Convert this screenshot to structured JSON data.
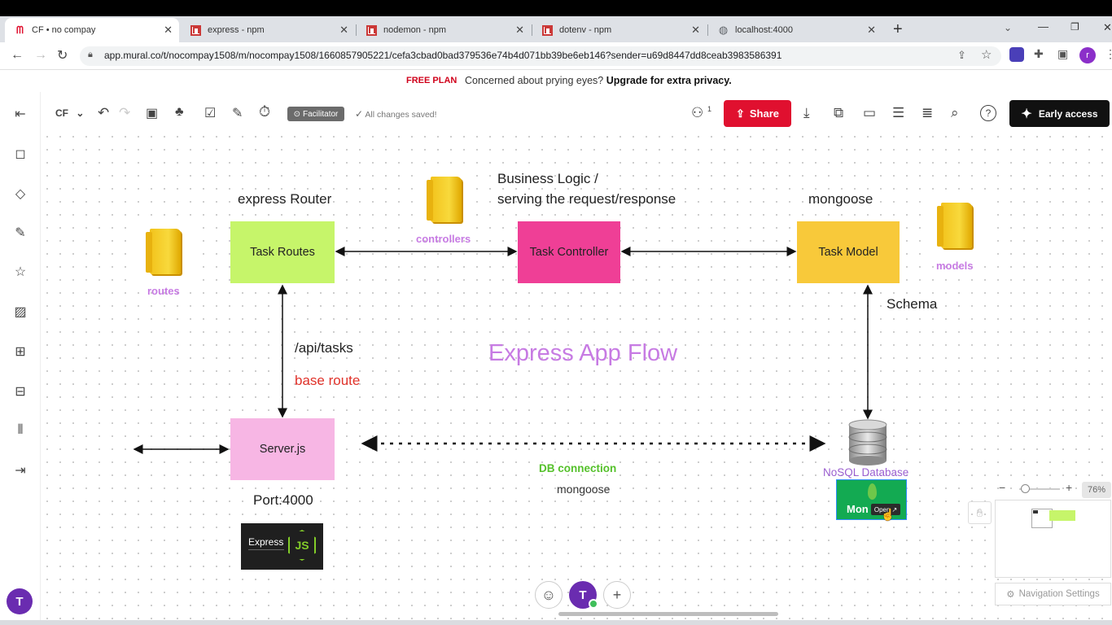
{
  "browser": {
    "tabs": [
      {
        "title": "CF • no compay",
        "active": true
      },
      {
        "title": "express - npm",
        "active": false
      },
      {
        "title": "nodemon - npm",
        "active": false
      },
      {
        "title": "dotenv - npm",
        "active": false
      },
      {
        "title": "localhost:4000",
        "active": false
      }
    ],
    "url": "app.mural.co/t/nocompay1508/m/nocompay1508/1660857905221/cefa3cbad0bad379536e74b4d071bb39be6eb146?sender=u69d8447dd8ceab3983586391",
    "profile_initial": "r"
  },
  "banner": {
    "plan": "FREE PLAN",
    "text": "Concerned about prying eyes?",
    "link": "Upgrade for extra privacy."
  },
  "toolbar": {
    "workspace": "CF",
    "facilitator": "Facilitator",
    "saved_status": "All changes saved!",
    "collaborator_count": "1",
    "share_label": "Share",
    "early_access_label": "Early access"
  },
  "board": {
    "title": "Express App Flow",
    "stickies": {
      "task_routes": "Task Routes",
      "task_controller": "Task Controller",
      "task_model": "Task Model",
      "server": "Server.js"
    },
    "labels": {
      "express_router": "express Router",
      "business_logic_1": "Business Logic /",
      "business_logic_2": "serving the request/response",
      "mongoose_top": "mongoose",
      "schema": "Schema",
      "api_tasks": "/api/tasks",
      "base_route": "base route",
      "port": "Port:4000",
      "db_connection": "DB connection",
      "mongoose_bottom": "mongoose",
      "nosql": "NoSQL Database",
      "mongo_text": "Mon",
      "open_tooltip": "Open"
    },
    "folders": {
      "routes": "routes",
      "controllers": "controllers",
      "models": "models"
    },
    "express_logo": {
      "text": "Express",
      "badge": "JS"
    }
  },
  "bottom": {
    "avatar_initial": "T",
    "sidebar_avatar": "T"
  },
  "navigation": {
    "zoom": "76%",
    "settings_label": "Navigation Settings"
  },
  "colors": {
    "task_routes": "#c6f56a",
    "task_controller": "#ef3f96",
    "task_model": "#f8c93a",
    "server": "#f7b6e4",
    "title_purple": "#c77be3",
    "base_route_red": "#e0322a",
    "db_green": "#55c12b",
    "share_red": "#e0102f",
    "mongo_green": "#13aa52"
  }
}
